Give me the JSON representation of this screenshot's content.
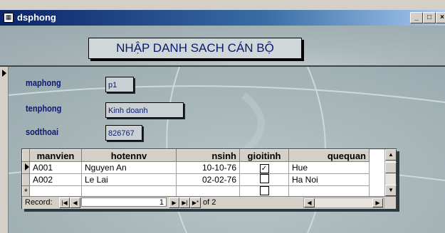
{
  "window": {
    "title": "dsphong",
    "icon": "form-icon",
    "controls": [
      "_",
      "□",
      "×"
    ]
  },
  "form": {
    "heading": "NHẬP DANH SACH CÁN BỘ",
    "fields": [
      {
        "label": "maphong",
        "value": "p1"
      },
      {
        "label": "tenphong",
        "value": "Kinh doanh"
      },
      {
        "label": "sodthoai",
        "value": "826767"
      }
    ]
  },
  "subform": {
    "columns": [
      "manvien",
      "hotennv",
      "nsinh",
      "gioitinh",
      "quequan"
    ],
    "rows": [
      {
        "manvien": "A001",
        "hotennv": "Nguyen An",
        "nsinh": "10-10-76",
        "gioitinh": true,
        "quequan": "Hue",
        "current": true
      },
      {
        "manvien": "A002",
        "hotennv": "Le Lai",
        "nsinh": "02-02-76",
        "gioitinh": false,
        "quequan": "Ha Noi",
        "current": false
      }
    ],
    "new_row_marker": "*",
    "navigator": {
      "label": "Record:",
      "current": "1",
      "total_text": "of 2"
    }
  }
}
